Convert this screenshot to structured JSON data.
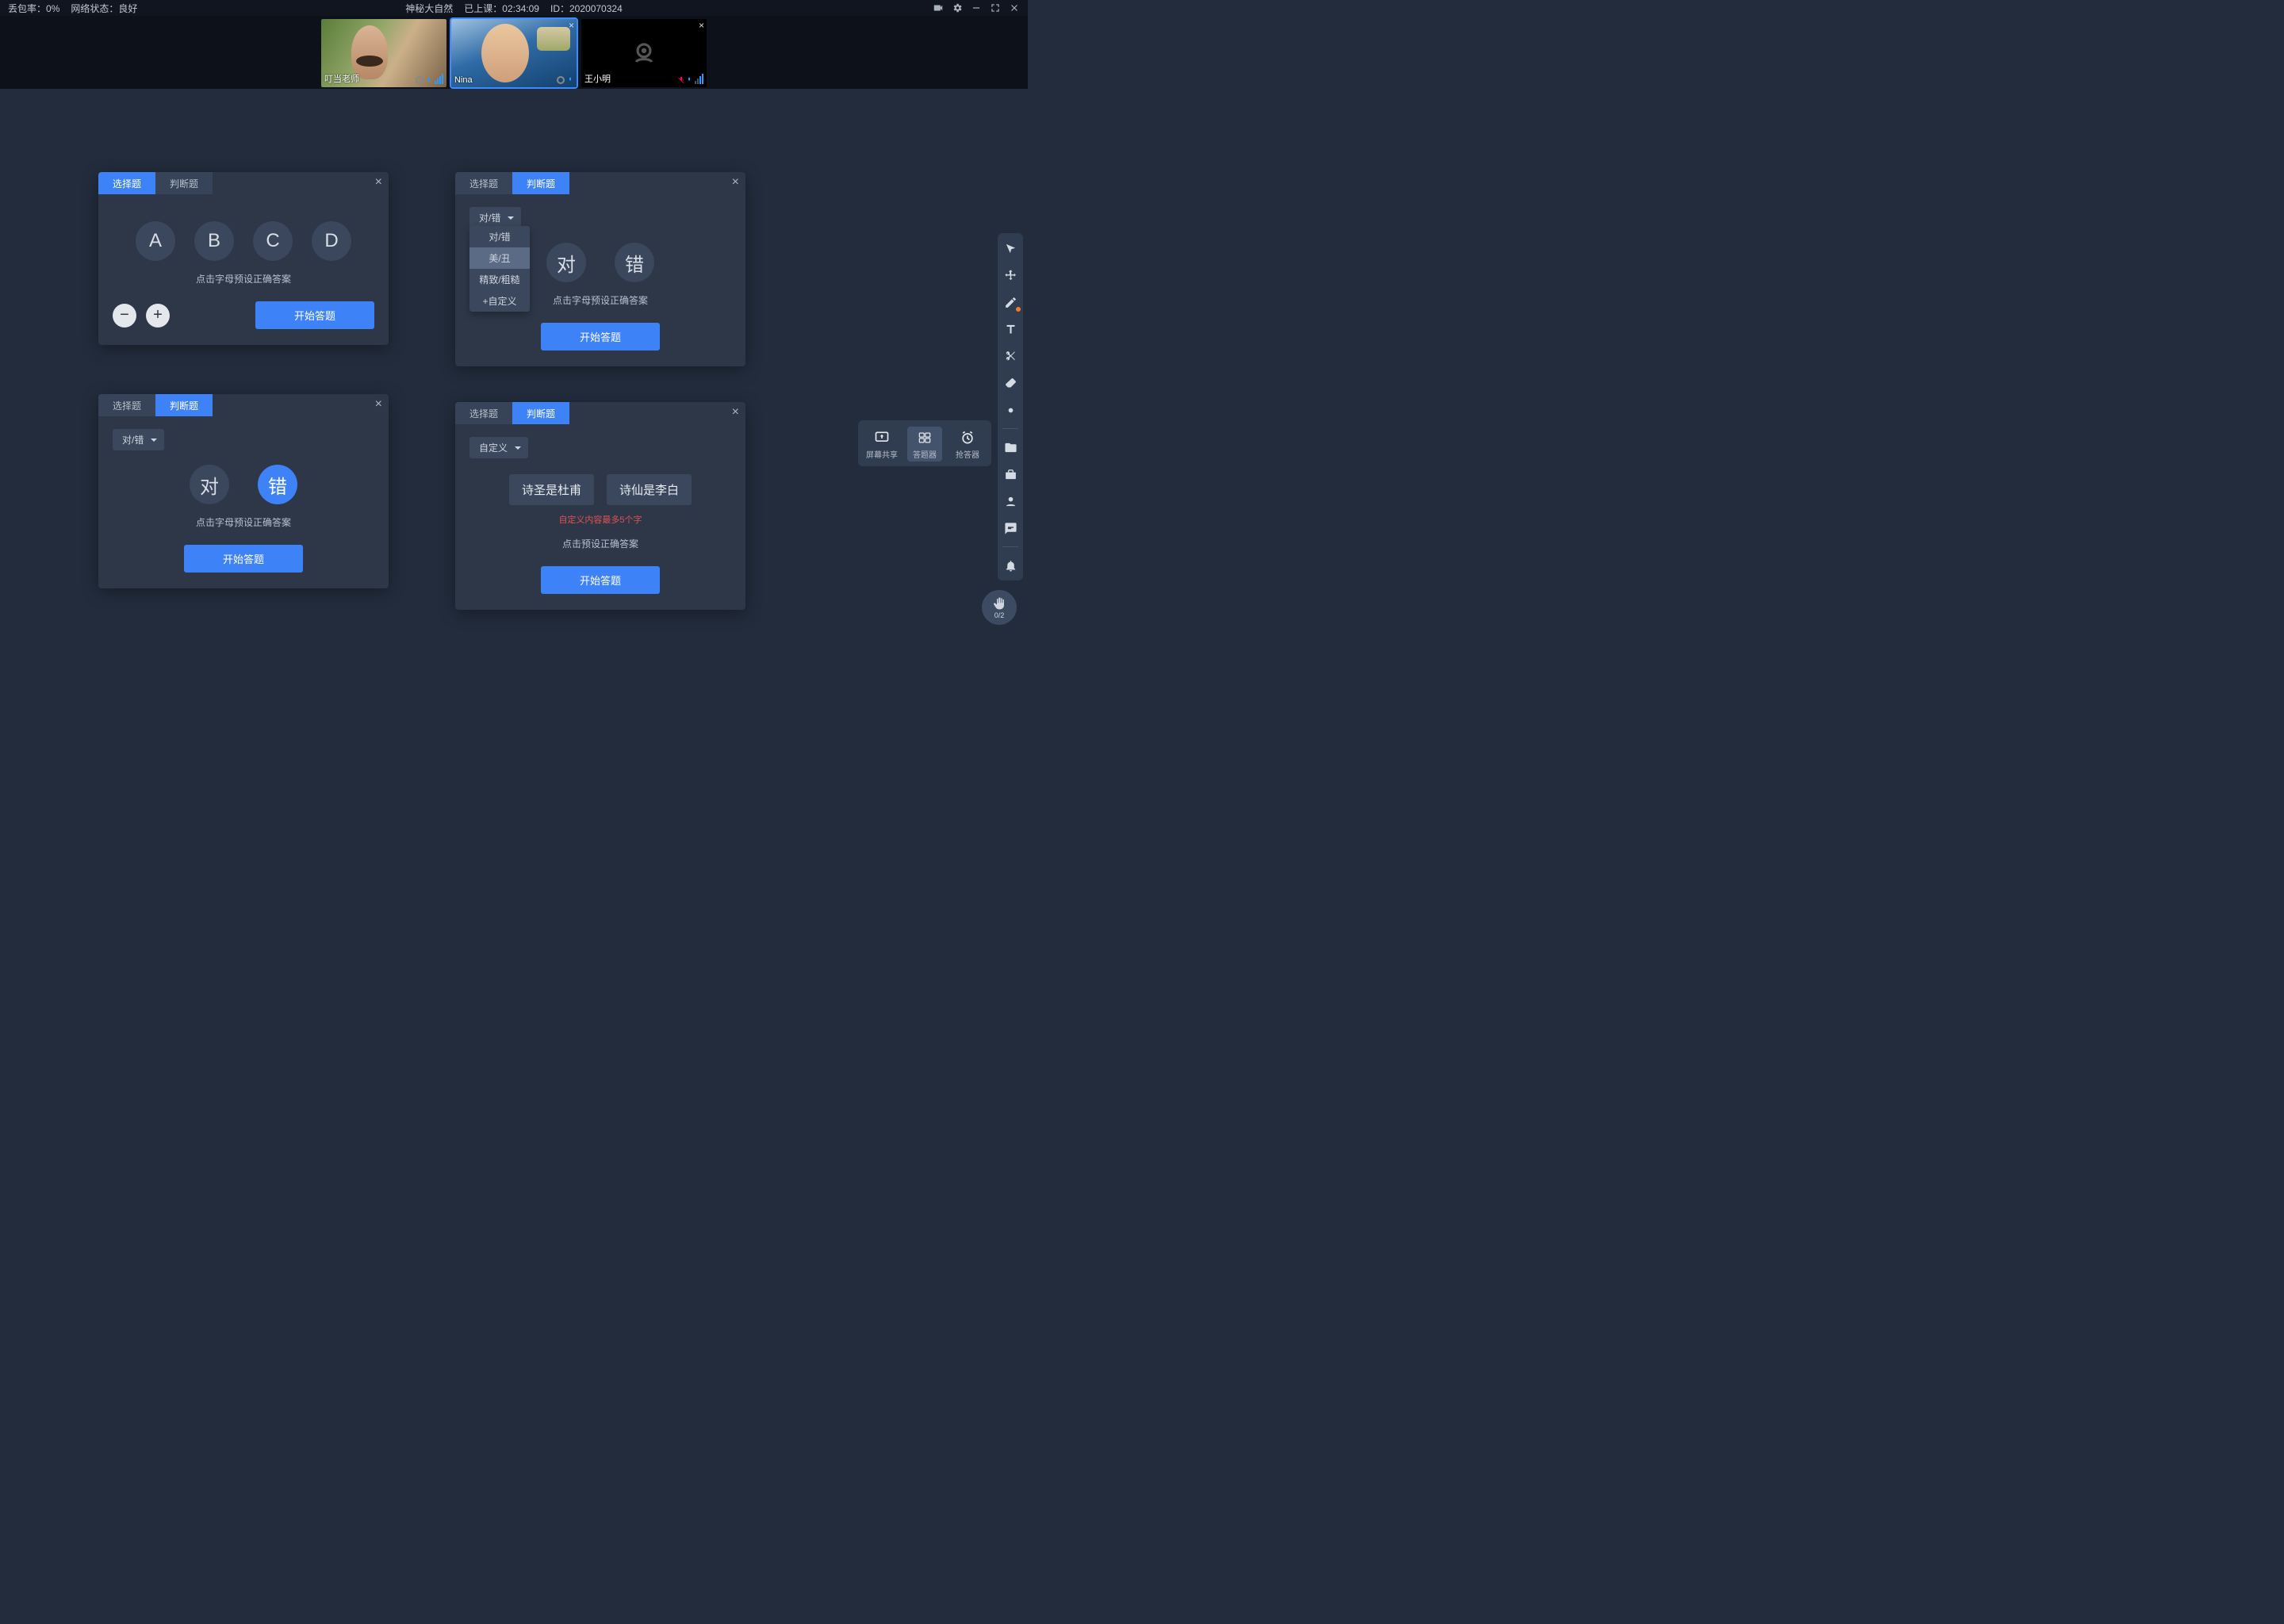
{
  "topbar": {
    "packet_loss_label": "丢包率：",
    "packet_loss_value": "0%",
    "network_label": "网络状态：",
    "network_value": "良好",
    "title": "神秘大自然",
    "class_time_label": "已上课：",
    "class_time_value": "02:34:09",
    "id_label": "ID：",
    "id_value": "2020070324"
  },
  "videos": [
    {
      "name": "叮当老师",
      "camera": "on",
      "selected": false,
      "img": "g1"
    },
    {
      "name": "Nina",
      "camera": "on",
      "selected": true,
      "img": "g2"
    },
    {
      "name": "王小明",
      "camera": "off",
      "selected": false,
      "img": ""
    }
  ],
  "labels": {
    "tab_choice": "选择题",
    "tab_truefalse": "判断题",
    "hint_preset": "点击字母预设正确答案",
    "hint_preset2": "点击预设正确答案",
    "btn_start": "开始答题",
    "err_maxlen": "自定义内容最多5个字"
  },
  "panel1": {
    "options": [
      "A",
      "B",
      "C",
      "D"
    ]
  },
  "panel2": {
    "dd_value": "对/错",
    "dd_items": [
      "对/错",
      "美/丑",
      "精致/粗糙",
      "+自定义"
    ],
    "left": "对",
    "right": "错"
  },
  "panel3": {
    "dd_value": "对/错",
    "left": "对",
    "right": "错",
    "selected": "right"
  },
  "panel4": {
    "dd_value": "自定义",
    "pills": [
      "诗圣是杜甫",
      "诗仙是李白"
    ]
  },
  "popup": {
    "share": "屏幕共享",
    "quiz": "答题器",
    "rush": "抢答器"
  },
  "hand": {
    "count": "0/2"
  }
}
